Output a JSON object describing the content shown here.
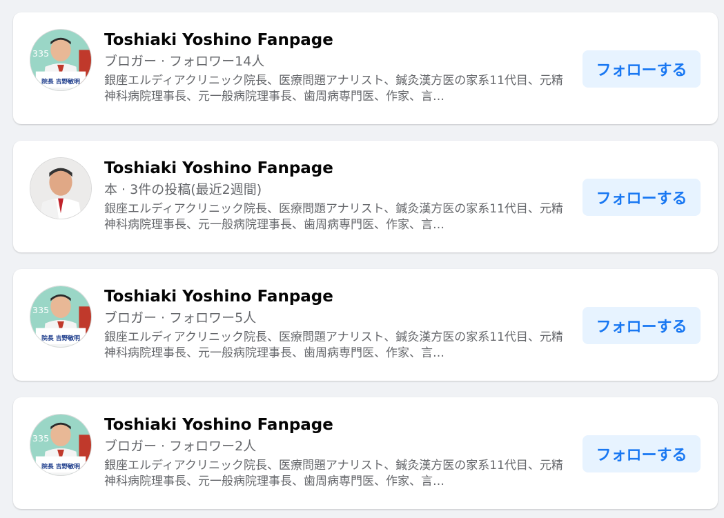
{
  "results": [
    {
      "name": "Toshiaki Yoshino Fanpage",
      "meta": "ブロガー · フォロワー14人",
      "description": "銀座エルディアクリニック院長、医療問題アナリスト、鍼灸漢方医の家系11代目、元精神科病院理事長、元一般病院理事長、歯周病専門医、作家、言…",
      "avatar": "poster-photo",
      "avatar_text": {
        "number": "335",
        "title": "院長 吉野敏明"
      },
      "follow_label": "フォローする"
    },
    {
      "name": "Toshiaki Yoshino Fanpage",
      "meta": "本 · 3件の投稿(最近2週間)",
      "description": "銀座エルディアクリニック院長、医療問題アナリスト、鍼灸漢方医の家系11代目、元精神科病院理事長、元一般病院理事長、歯周病専門医、作家、言…",
      "avatar": "portrait-photo",
      "follow_label": "フォローする"
    },
    {
      "name": "Toshiaki Yoshino Fanpage",
      "meta": "ブロガー · フォロワー5人",
      "description": "銀座エルディアクリニック院長、医療問題アナリスト、鍼灸漢方医の家系11代目、元精神科病院理事長、元一般病院理事長、歯周病専門医、作家、言…",
      "avatar": "poster-photo",
      "avatar_text": {
        "number": "335",
        "title": "院長 吉野敏明"
      },
      "follow_label": "フォローする"
    },
    {
      "name": "Toshiaki Yoshino Fanpage",
      "meta": "ブロガー · フォロワー2人",
      "description": "銀座エルディアクリニック院長、医療問題アナリスト、鍼灸漢方医の家系11代目、元精神科病院理事長、元一般病院理事長、歯周病専門医、作家、言…",
      "avatar": "poster-photo",
      "avatar_text": {
        "number": "335",
        "title": "院長 吉野敏明"
      },
      "follow_label": "フォローする"
    }
  ]
}
